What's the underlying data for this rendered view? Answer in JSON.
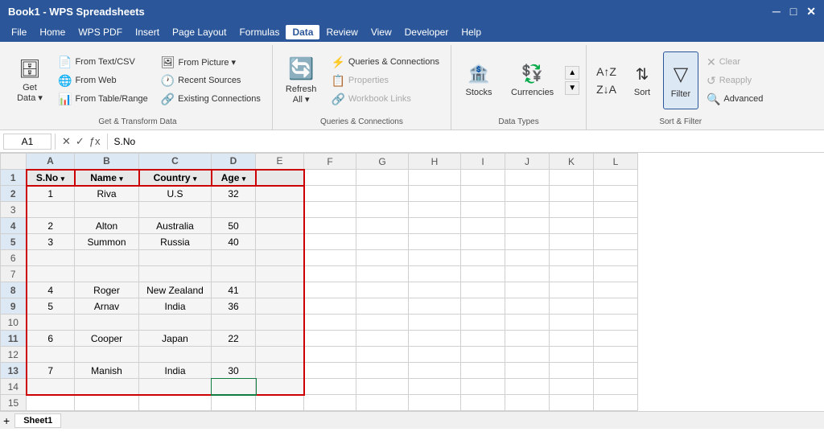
{
  "app": {
    "title": "Book1 - WPS Spreadsheets",
    "tabs_window": [
      "─",
      "□",
      "✕"
    ]
  },
  "menu": {
    "items": [
      "File",
      "Home",
      "WPS PDF",
      "Insert",
      "Page Layout",
      "Formulas",
      "Data",
      "Review",
      "View",
      "Developer",
      "Help"
    ],
    "active": "Data"
  },
  "ribbon": {
    "groups": [
      {
        "label": "Get & Transform Data",
        "buttons_large": [
          {
            "id": "get-data",
            "icon": "🗄",
            "label": "Get\nData ▾"
          }
        ],
        "buttons_small_cols": [
          [
            {
              "id": "from-text-csv",
              "icon": "📄",
              "label": "From Text/CSV"
            },
            {
              "id": "from-web",
              "icon": "🌐",
              "label": "From Web"
            },
            {
              "id": "from-table",
              "icon": "📊",
              "label": "From Table/Range"
            }
          ],
          [
            {
              "id": "from-picture",
              "icon": "🖼",
              "label": "From Picture ▾"
            },
            {
              "id": "recent-sources",
              "icon": "🕐",
              "label": "Recent Sources"
            },
            {
              "id": "existing-conn",
              "icon": "🔗",
              "label": "Existing Connections"
            }
          ]
        ]
      },
      {
        "label": "Queries & Connections",
        "buttons_small": [
          {
            "id": "queries-conn",
            "icon": "⚡",
            "label": "Queries & Connections"
          },
          {
            "id": "properties",
            "icon": "📋",
            "label": "Properties",
            "disabled": true
          },
          {
            "id": "workbook-links",
            "icon": "🔗",
            "label": "Workbook Links",
            "disabled": true
          }
        ],
        "buttons_large": [
          {
            "id": "refresh-all",
            "icon": "🔄",
            "label": "Refresh\nAll ▾"
          }
        ]
      },
      {
        "label": "Data Types",
        "buttons_large": [
          {
            "id": "stocks",
            "icon": "🏦",
            "label": "Stocks"
          },
          {
            "id": "currencies",
            "icon": "💱",
            "label": "Currencies"
          }
        ]
      },
      {
        "label": "Sort & Filter",
        "buttons_large": [
          {
            "id": "sort-asc",
            "icon": "↑",
            "label": ""
          },
          {
            "id": "sort-desc",
            "icon": "↓",
            "label": ""
          },
          {
            "id": "sort",
            "icon": "⇅",
            "label": "Sort"
          },
          {
            "id": "filter",
            "icon": "▽",
            "label": "Filter",
            "active": true
          }
        ],
        "buttons_right": [
          {
            "id": "clear",
            "icon": "✕",
            "label": "Clear"
          },
          {
            "id": "reapply",
            "icon": "↺",
            "label": "Reapply"
          },
          {
            "id": "advanced",
            "icon": "🔍",
            "label": "Advanced"
          }
        ]
      }
    ]
  },
  "formula_bar": {
    "cell_ref": "A1",
    "formula": "S.No"
  },
  "spreadsheet": {
    "col_headers": [
      "",
      "A",
      "B",
      "C",
      "D",
      "E",
      "F",
      "G",
      "H",
      "I",
      "J",
      "K",
      "L"
    ],
    "rows": [
      {
        "row": 1,
        "cells": [
          "S.No ▾",
          "Name ▾",
          "Country ▾",
          "Age ▾",
          ""
        ],
        "is_header": true
      },
      {
        "row": 2,
        "cells": [
          "1",
          "Riva",
          "U.S",
          "32",
          ""
        ]
      },
      {
        "row": 3,
        "cells": [
          "",
          "",
          "",
          "",
          ""
        ]
      },
      {
        "row": 4,
        "cells": [
          "2",
          "Alton",
          "Australia",
          "50",
          ""
        ]
      },
      {
        "row": 5,
        "cells": [
          "3",
          "Summon",
          "Russia",
          "40",
          ""
        ]
      },
      {
        "row": 6,
        "cells": [
          "",
          "",
          "",
          "",
          ""
        ]
      },
      {
        "row": 7,
        "cells": [
          "",
          "",
          "",
          "",
          ""
        ]
      },
      {
        "row": 8,
        "cells": [
          "4",
          "Roger",
          "New Zealand",
          "41",
          ""
        ]
      },
      {
        "row": 9,
        "cells": [
          "5",
          "Arnav",
          "India",
          "36",
          ""
        ]
      },
      {
        "row": 10,
        "cells": [
          "",
          "",
          "",
          "",
          ""
        ]
      },
      {
        "row": 11,
        "cells": [
          "6",
          "Cooper",
          "Japan",
          "22",
          ""
        ]
      },
      {
        "row": 12,
        "cells": [
          "",
          "",
          "",
          "",
          ""
        ]
      },
      {
        "row": 13,
        "cells": [
          "7",
          "Manish",
          "India",
          "30",
          ""
        ]
      },
      {
        "row": 14,
        "cells": [
          "",
          "",
          "",
          "",
          ""
        ]
      },
      {
        "row": 15,
        "cells": [
          "",
          "",
          "",
          "",
          ""
        ]
      }
    ],
    "data_cols": [
      1,
      2,
      3,
      4
    ]
  },
  "sheet_tabs": [
    "Sheet1"
  ]
}
